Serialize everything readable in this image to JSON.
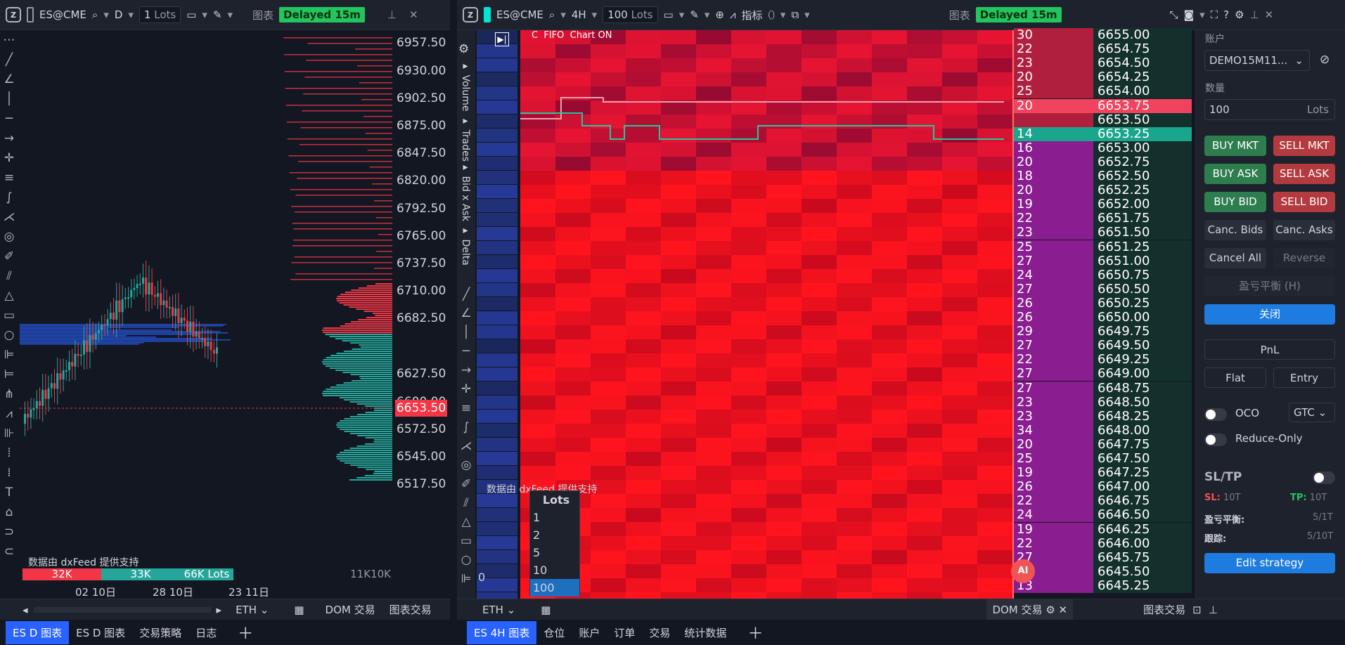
{
  "left": {
    "symbol": "ES@CME",
    "interval": "D",
    "qty": "1",
    "qty_unit": "Lots",
    "chart_label": "图表",
    "delayed": "Delayed 15m",
    "prices": [
      "6957.50",
      "6930.00",
      "6902.50",
      "6875.00",
      "6847.50",
      "6820.00",
      "6792.50",
      "6765.00",
      "6737.50",
      "6710.00",
      "6682.50",
      "6627.50",
      "6600.00",
      "6572.50",
      "6545.00",
      "6517.50"
    ],
    "current_price": "6653.50",
    "dates": [
      "02 10日",
      "28 10日",
      "23 11日"
    ],
    "feed": "数据由 dxFeed 提供支持",
    "vol_segments": [
      "32K",
      "33K",
      "66K Lots"
    ],
    "vol_right": "11K10K",
    "session": "ETH",
    "dom_trade": "DOM 交易",
    "chart_trade": "图表交易"
  },
  "right": {
    "symbol": "ES@CME",
    "interval": "4H",
    "qty": "100",
    "qty_unit": "Lots",
    "indicators": "指标",
    "chart_label": "图表",
    "delayed": "Delayed 15m",
    "flags": "C  FIFO  Chart ON",
    "side_labels": [
      "Volume",
      "Trades",
      "Bid x Ask",
      "Delta"
    ],
    "feed": "数据由 dxFeed 提供支持",
    "session": "ETH",
    "dom_tab": "DOM 交易",
    "chart_trade": "图表交易",
    "dom_rows": [
      {
        "qty": "30",
        "price": "6655.00"
      },
      {
        "qty": "22",
        "price": "6654.75"
      },
      {
        "qty": "23",
        "price": "6654.50"
      },
      {
        "qty": "20",
        "price": "6654.25"
      },
      {
        "qty": "25",
        "price": "6654.00"
      },
      {
        "qty": "20",
        "price": "6653.75"
      },
      {
        "qty": "",
        "price": "6653.50"
      },
      {
        "qty": "14",
        "price": "6653.25"
      },
      {
        "qty": "16",
        "price": "6653.00"
      },
      {
        "qty": "20",
        "price": "6652.75"
      },
      {
        "qty": "18",
        "price": "6652.50"
      },
      {
        "qty": "20",
        "price": "6652.25"
      },
      {
        "qty": "19",
        "price": "6652.00"
      },
      {
        "qty": "22",
        "price": "6651.75"
      },
      {
        "qty": "23",
        "price": "6651.50"
      },
      {
        "qty": "25",
        "price": "6651.25"
      },
      {
        "qty": "27",
        "price": "6651.00"
      },
      {
        "qty": "24",
        "price": "6650.75"
      },
      {
        "qty": "27",
        "price": "6650.50"
      },
      {
        "qty": "26",
        "price": "6650.25"
      },
      {
        "qty": "26",
        "price": "6650.00"
      },
      {
        "qty": "29",
        "price": "6649.75"
      },
      {
        "qty": "27",
        "price": "6649.50"
      },
      {
        "qty": "22",
        "price": "6649.25"
      },
      {
        "qty": "27",
        "price": "6649.00"
      },
      {
        "qty": "27",
        "price": "6648.75"
      },
      {
        "qty": "23",
        "price": "6648.50"
      },
      {
        "qty": "23",
        "price": "6648.25"
      },
      {
        "qty": "34",
        "price": "6648.00"
      },
      {
        "qty": "20",
        "price": "6647.75"
      },
      {
        "qty": "25",
        "price": "6647.50"
      },
      {
        "qty": "19",
        "price": "6647.25"
      },
      {
        "qty": "26",
        "price": "6647.00"
      },
      {
        "qty": "22",
        "price": "6646.75"
      },
      {
        "qty": "24",
        "price": "6646.50"
      },
      {
        "qty": "19",
        "price": "6646.25"
      },
      {
        "qty": "22",
        "price": "6646.00"
      },
      {
        "qty": "27",
        "price": "6645.75"
      },
      {
        "qty": "20",
        "price": "6645.50"
      },
      {
        "qty": "13",
        "price": "6645.25"
      }
    ],
    "lots_menu": {
      "title": "Lots",
      "options": [
        "1",
        "2",
        "5",
        "10",
        "100"
      ],
      "selected": "100"
    },
    "zero": "0"
  },
  "panel": {
    "account_label": "账户",
    "account": "DEMO15M11...",
    "qty_label": "数量",
    "qty": "100",
    "qty_unit": "Lots",
    "buy_mkt": "BUY MKT",
    "sell_mkt": "SELL MKT",
    "buy_ask": "BUY ASK",
    "sell_ask": "SELL ASK",
    "buy_bid": "BUY BID",
    "sell_bid": "SELL BID",
    "canc_bids": "Canc. Bids",
    "canc_asks": "Canc. Asks",
    "cancel_all": "Cancel All",
    "reverse": "Reverse",
    "breakeven": "盈亏平衡 (H)",
    "close": "关闭",
    "pnl": "PnL",
    "flat": "Flat",
    "entry": "Entry",
    "oco": "OCO",
    "tif": "GTC",
    "reduce_only": "Reduce-Only",
    "sltp": "SL/TP",
    "sl_label": "SL:",
    "sl_val": "10T",
    "tp_label": "TP:",
    "tp_val": "10T",
    "be_label": "盈亏平衡:",
    "be_val": "5/1T",
    "trail_label": "跟踪:",
    "trail_val": "5/10T",
    "edit_strategy": "Edit strategy"
  },
  "tabs_left": [
    "ES D 图表",
    "ES D 图表",
    "交易策略",
    "日志"
  ],
  "tabs_right": [
    "ES 4H 图表",
    "仓位",
    "账户",
    "订单",
    "交易",
    "统计数据"
  ],
  "colors": {
    "up": "#26a69a",
    "down": "#f23645",
    "blue": "#2962ff",
    "bg": "#131722"
  }
}
